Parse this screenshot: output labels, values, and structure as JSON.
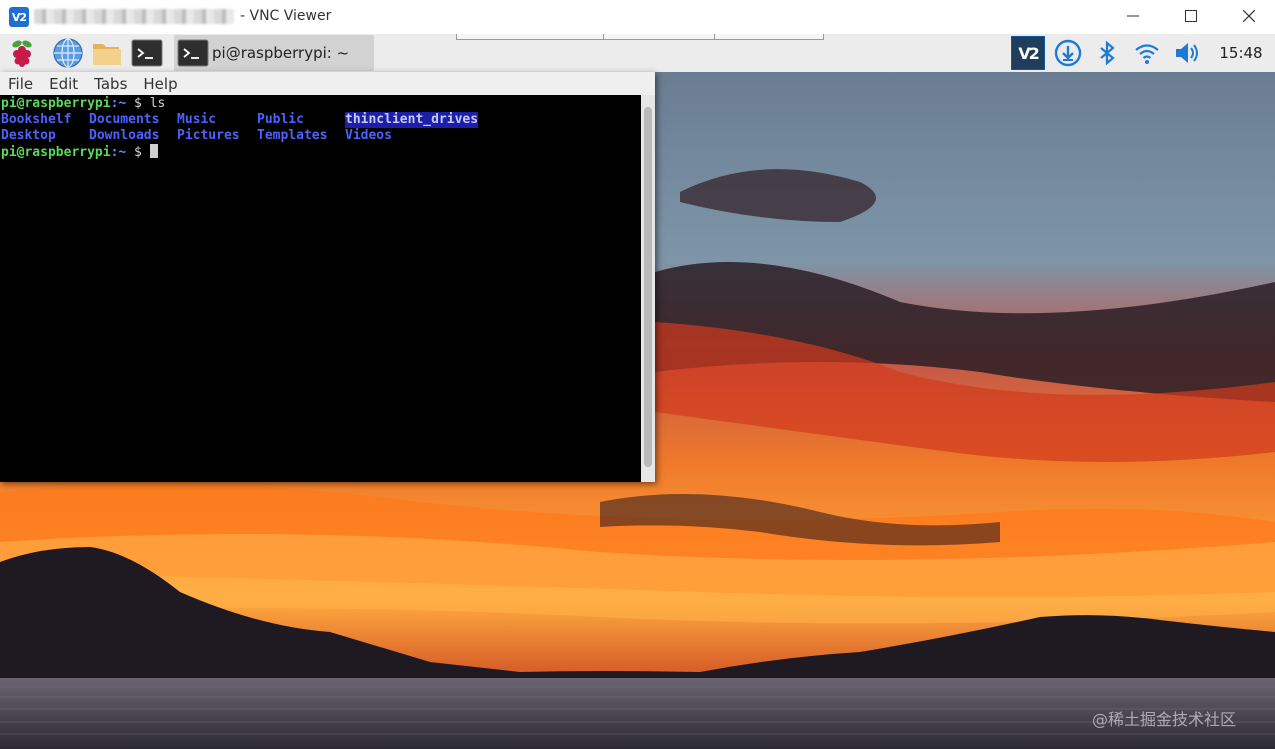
{
  "vnc_window": {
    "title": "- VNC Viewer",
    "logo_text": "V2",
    "controls": {
      "minimize_icon": "minimize-icon",
      "maximize_icon": "maximize-icon",
      "close_icon": "close-icon"
    }
  },
  "taskbar": {
    "launchers": [
      {
        "name": "raspberry-menu",
        "icon": "raspberry-icon"
      },
      {
        "name": "web-browser",
        "icon": "globe-icon"
      },
      {
        "name": "file-manager",
        "icon": "folder-icon"
      },
      {
        "name": "terminal",
        "icon": "terminal-icon"
      }
    ],
    "active_task_label": "pi@raspberrypi: ~",
    "tray": {
      "vnc_label": "V2",
      "icons": [
        "vnc-icon",
        "update-icon",
        "bluetooth-icon",
        "wifi-icon",
        "volume-icon"
      ],
      "clock": "15:48"
    }
  },
  "terminal": {
    "menu": [
      "File",
      "Edit",
      "Tabs",
      "Help"
    ],
    "lines": [
      {
        "user": "pi@raspberrypi",
        "path": ":~",
        "cmd": " $ ls"
      },
      {
        "dirs": [
          "Bookshelf",
          "Documents",
          "Music",
          "Public",
          "thinclient_drives"
        ]
      },
      {
        "dirs": [
          "Desktop",
          "Downloads",
          "Pictures",
          "Templates",
          "Videos"
        ]
      },
      {
        "user": "pi@raspberrypi",
        "path": ":~",
        "cmd": " $ "
      }
    ]
  },
  "desktop": {
    "watermark": "@稀土掘金技术社区"
  },
  "colors": {
    "prompt_user": "#59d859",
    "prompt_path": "#5f8cff",
    "directory": "#4c62ff",
    "highlight_bg": "#1d1fa8"
  }
}
